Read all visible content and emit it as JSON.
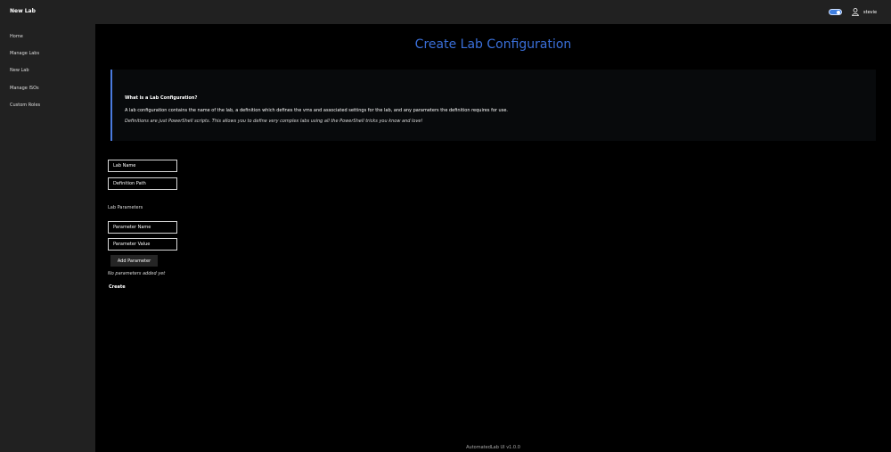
{
  "header": {
    "title": "New Lab",
    "theme_toggle_on": true,
    "user_icon": "user-icon",
    "username": "stevie"
  },
  "sidebar": {
    "items": [
      {
        "label": "Home"
      },
      {
        "label": "Manage Labs"
      },
      {
        "label": "New Lab"
      },
      {
        "label": "Manage ISOs"
      },
      {
        "label": "Custom Roles"
      }
    ]
  },
  "main": {
    "title": "Create Lab Configuration",
    "info": {
      "heading": "What is a Lab Configuration?",
      "text": "A lab configuration contains the name of the lab, a definition which defines the vms and associated settings for the lab, and any parameters the definition requires for use.",
      "note": "Definitions are just PowerShell scripts. This allows you to define very complex labs using all the PowerShell tricks you know and love!"
    },
    "form": {
      "lab_name_placeholder": "Lab Name",
      "definition_path_placeholder": "Definition Path",
      "parameters_label": "Lab Parameters",
      "parameter_name_placeholder": "Parameter Name",
      "parameter_value_placeholder": "Parameter Value",
      "add_parameter_label": "Add Parameter",
      "empty_message": "No parameters added yet",
      "create_label": "Create"
    },
    "footer": "AutomatedLab UI v1.0.0"
  },
  "colors": {
    "accent": "#3a6fd9",
    "topbar": "#212121",
    "sidebar": "#212121",
    "background": "#000000"
  }
}
